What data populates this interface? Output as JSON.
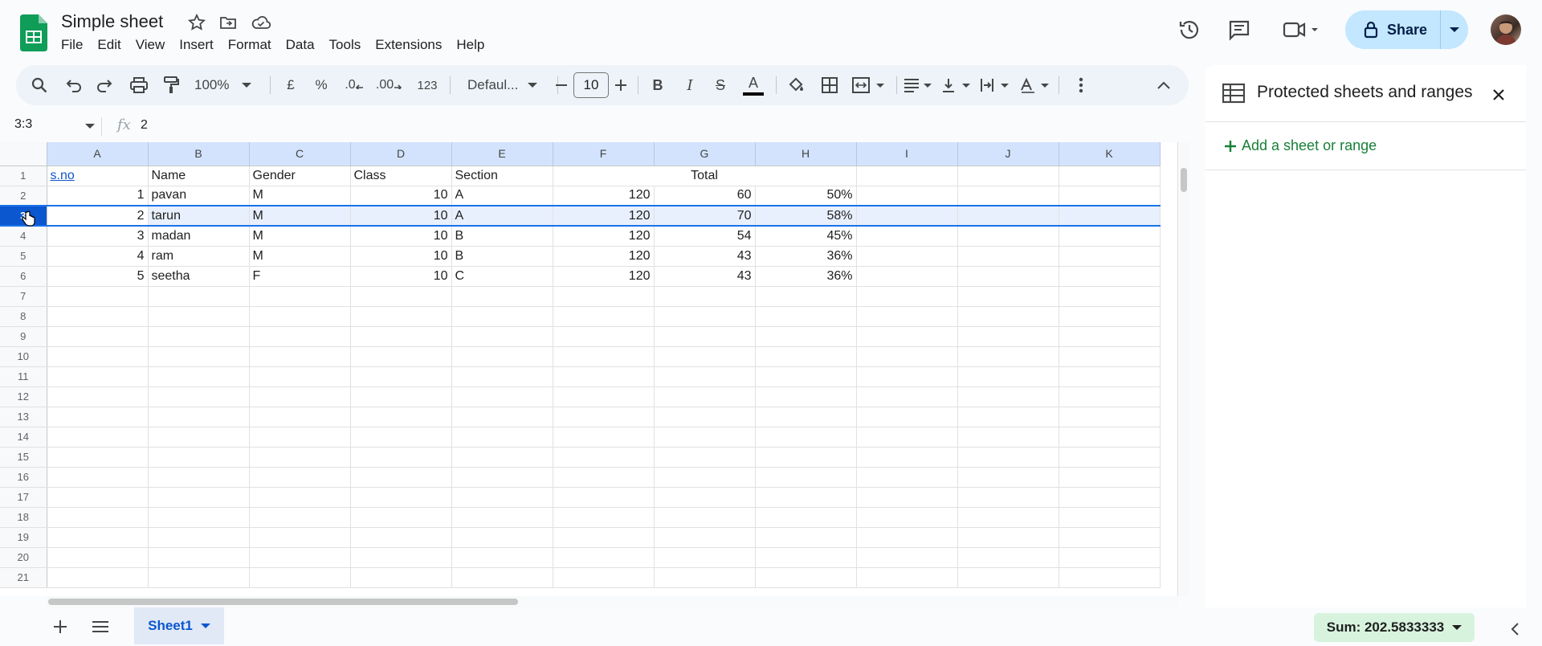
{
  "app": {
    "doc_title": "Simple sheet",
    "menus": [
      "File",
      "Edit",
      "View",
      "Insert",
      "Format",
      "Data",
      "Tools",
      "Extensions",
      "Help"
    ],
    "share_label": "Share"
  },
  "toolbar": {
    "zoom": "100%",
    "currency": "£",
    "percent": "%",
    "decrease_decimals": ".0",
    "increase_decimals": ".00",
    "number_format": "123",
    "font_name": "Defaul...",
    "font_size": "10"
  },
  "formula_bar": {
    "name_box": "3:3",
    "fx": "fx",
    "value": "2"
  },
  "grid": {
    "columns": [
      "A",
      "B",
      "C",
      "D",
      "E",
      "F",
      "G",
      "H",
      "I",
      "J",
      "K"
    ],
    "row_numbers": [
      "1",
      "2",
      "3",
      "4",
      "5",
      "6",
      "7",
      "8",
      "9",
      "10",
      "11",
      "12",
      "13",
      "14",
      "15",
      "16",
      "17",
      "18",
      "19",
      "20",
      "21"
    ],
    "header_row": {
      "a": "s.no",
      "b": "Name",
      "c": "Gender",
      "d": "Class",
      "e": "Section",
      "total": "Total"
    },
    "rows": [
      {
        "sno": "1",
        "name": "pavan",
        "gender": "M",
        "class": "10",
        "section": "A",
        "total": "120",
        "marks": "60",
        "pct": "50%"
      },
      {
        "sno": "2",
        "name": "tarun",
        "gender": "M",
        "class": "10",
        "section": "A",
        "total": "120",
        "marks": "70",
        "pct": "58%"
      },
      {
        "sno": "3",
        "name": "madan",
        "gender": "M",
        "class": "10",
        "section": "B",
        "total": "120",
        "marks": "54",
        "pct": "45%"
      },
      {
        "sno": "4",
        "name": "ram",
        "gender": "M",
        "class": "10",
        "section": "B",
        "total": "120",
        "marks": "43",
        "pct": "36%"
      },
      {
        "sno": "5",
        "name": "seetha",
        "gender": "F",
        "class": "10",
        "section": "C",
        "total": "120",
        "marks": "43",
        "pct": "36%"
      }
    ],
    "selected_row": 3
  },
  "side_panel": {
    "title": "Protected sheets and ranges",
    "add_label": "Add a sheet or range"
  },
  "bottom": {
    "sheet_name": "Sheet1",
    "sum_label": "Sum: 202.5833333"
  },
  "colors": {
    "accent": "#0b57d0",
    "share_bg": "#c2e7ff",
    "header_selected": "#d3e3fd",
    "green": "#188038",
    "sum_bg": "#d7f3dd"
  }
}
